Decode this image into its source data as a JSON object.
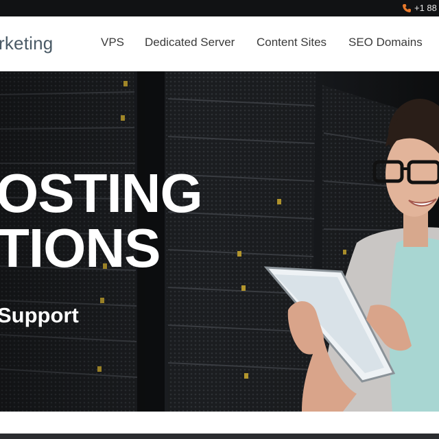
{
  "topbar": {
    "phone_icon": "phone-icon",
    "phone_text": "+1 88"
  },
  "header": {
    "logo_text": "rketing",
    "nav": {
      "vps": "VPS",
      "dedicated": "Dedicated Server",
      "content": "Content Sites",
      "seo": "SEO Domains"
    }
  },
  "hero": {
    "title_line1": "OSTING",
    "title_line2": "TIONS",
    "subtitle": "Support"
  },
  "colors": {
    "accent_orange": "#e8792b",
    "topbar_bg": "#111214",
    "header_bg": "#ffffff",
    "nav_text": "#3a3a3a",
    "logo_text": "#4a5a66",
    "hero_text": "#ffffff"
  }
}
